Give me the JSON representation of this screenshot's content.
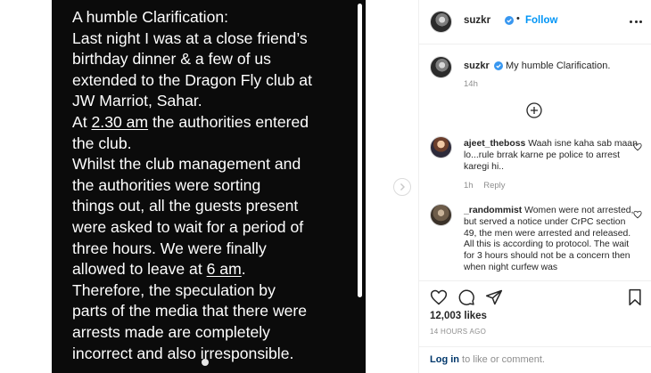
{
  "post_image": {
    "lines": [
      "A humble Clarification:",
      "Last night I was at a close friend’s",
      "birthday dinner & a few of us",
      "extended to the Dragon Fly club at",
      "JW Marriot, Sahar.",
      "At ",
      "2.30 am",
      " the authorities entered",
      "the club.",
      "Whilst the club management and",
      "the  authorities were sorting",
      "things out, all the guests  present",
      "were asked to wait for a period of",
      "three hours. We were finally",
      "allowed to leave at ",
      "6 am",
      ".",
      "Therefore, the speculation by",
      "parts of the media that there were",
      "arrests made are completely",
      "incorrect and also irresponsible."
    ]
  },
  "header": {
    "username": "suzkr",
    "separator": "•",
    "follow_label": "Follow"
  },
  "caption": {
    "username": "suzkr",
    "text": "My humble Clarification.",
    "time": "14h"
  },
  "comments": [
    {
      "username": "ajeet_theboss",
      "text": "Waah isne kaha sab maan lo...rule brrak karne pe police to arrest karegi hi..",
      "time": "1h",
      "reply_label": "Reply"
    },
    {
      "username": "_randommist",
      "text": "Women were not arrested, but served a notice under CrPC section 49, the men were arrested and released. All this is according to protocol. The wait for 3 hours should not be a concern then when night curfew was"
    }
  ],
  "actions": {
    "likes": "12,003 likes",
    "posted_time": "14 HOURS AGO"
  },
  "login": {
    "link": "Log in",
    "rest": " to like or comment."
  },
  "icons": {
    "verified": "verified-badge-icon",
    "more": "more-options-icon",
    "load_more": "load-more-comments-icon",
    "like": "heart-icon",
    "comment": "comment-icon",
    "share": "share-icon",
    "save": "bookmark-icon",
    "next": "chevron-right-icon"
  },
  "colors": {
    "link_blue": "#0095f6",
    "verified_blue": "#3897f0",
    "text": "#262626",
    "muted": "#8e8e8e",
    "post_bg": "#0b0b0b"
  }
}
